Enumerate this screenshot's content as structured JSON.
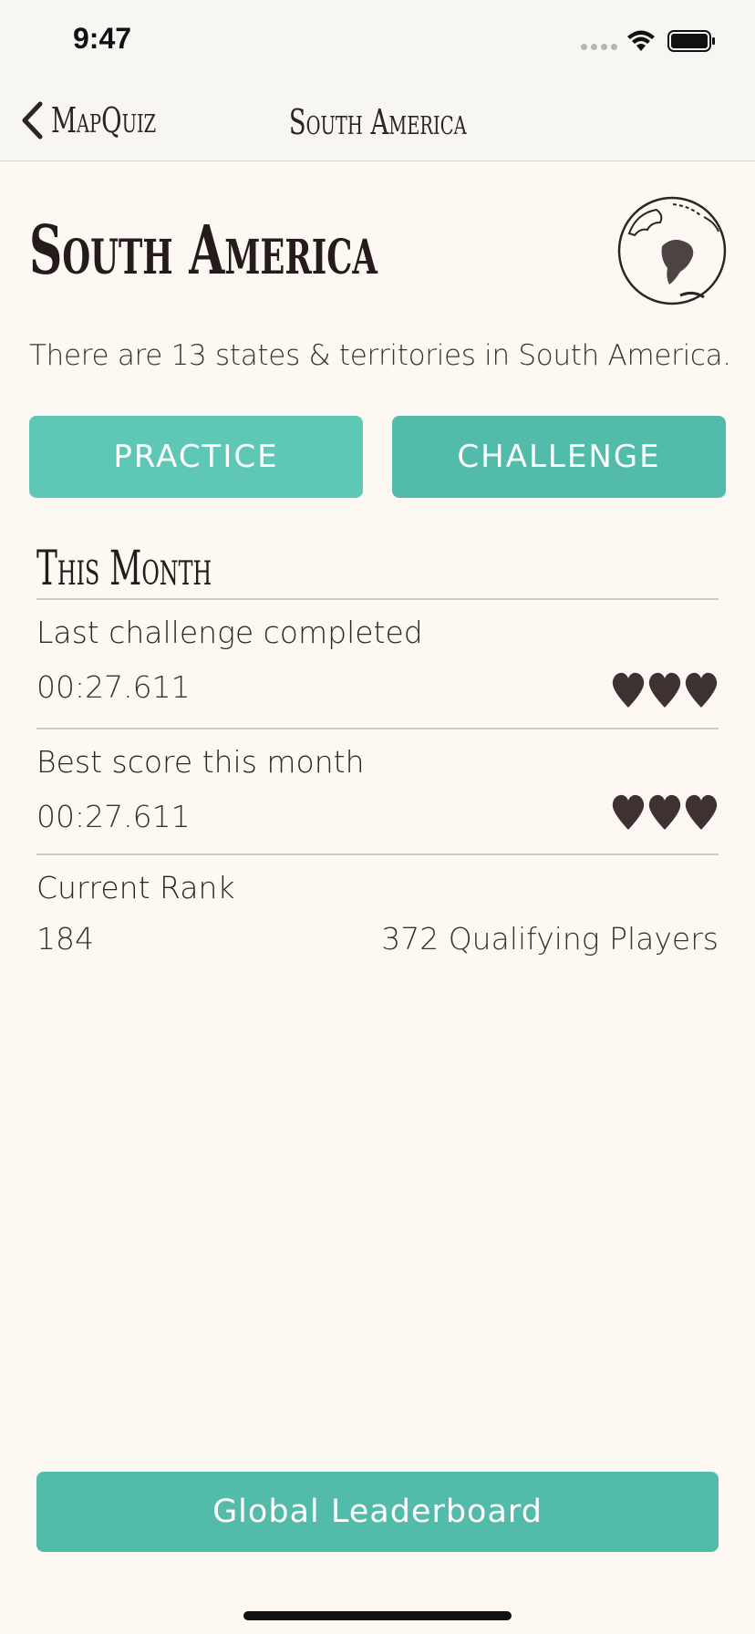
{
  "status_bar": {
    "time": "9:47"
  },
  "nav": {
    "back_label": "MapQuiz",
    "title": "South America"
  },
  "header": {
    "title": "South America",
    "description": "There are 13 states & territories in South America."
  },
  "actions": {
    "practice_label": "PRACTICE",
    "challenge_label": "CHALLENGE"
  },
  "stats": {
    "section_title": "This Month",
    "last_challenge": {
      "label": "Last challenge completed",
      "value": "00:27.611",
      "hearts": 3
    },
    "best_score": {
      "label": "Best score this month",
      "value": "00:27.611",
      "hearts": 3
    },
    "rank": {
      "label": "Current Rank",
      "value": "184",
      "qualifying": "372 Qualifying Players"
    }
  },
  "footer": {
    "leaderboard_label": "Global Leaderboard"
  },
  "colors": {
    "background": "#fdf8f2",
    "accent": "#52bba9",
    "accent_light": "#5ec7b6",
    "text": "#2c2523"
  }
}
